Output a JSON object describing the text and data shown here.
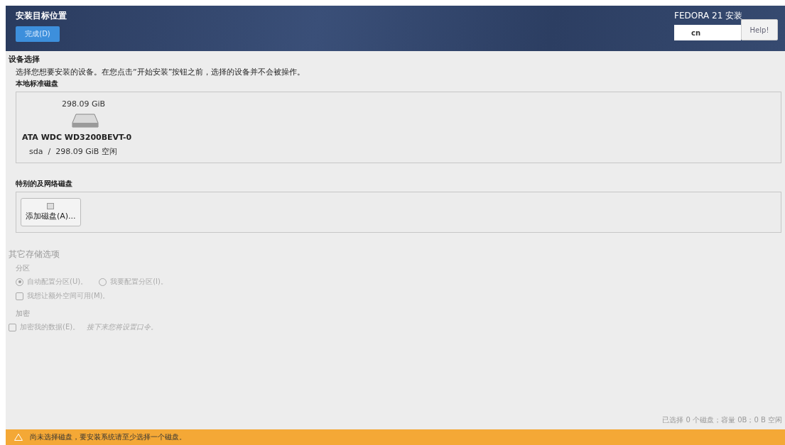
{
  "header": {
    "title": "安装目标位置",
    "done_button": "完成(D)",
    "product": "FEDORA 21 安装",
    "keyboard": "cn",
    "help_button": "Help!"
  },
  "device_selection": {
    "title": "设备选择",
    "description": "选择您想要安装的设备。在您点击“开始安装”按钮之前，选择的设备并不会被操作。",
    "local_disks": {
      "label": "本地标准磁盘",
      "disks": [
        {
          "size": "298.09 GiB",
          "name": "ATA WDC WD3200BEVT-0",
          "device": "sda",
          "separator": "/",
          "free": "298.09 GiB 空闲",
          "selected": false
        }
      ]
    },
    "special_disks": {
      "label": "特别的及网络磁盘",
      "add_button": "添加磁盘(A)..."
    }
  },
  "other_options": {
    "title": "其它存储选项",
    "disabled": true,
    "partitioning": {
      "label": "分区",
      "radios": [
        {
          "label": "自动配置分区(U)。",
          "selected": true
        },
        {
          "label": "我要配置分区(I)。",
          "selected": false
        }
      ],
      "extra_space": {
        "label": "我想让额外空间可用(M)。",
        "checked": false
      }
    },
    "encryption": {
      "label": "加密",
      "checkbox": {
        "label": "加密我的数据(E)。",
        "checked": false
      },
      "note": "接下来您将设置口令。"
    }
  },
  "summary": "已选择 0 个磁盘；容量 0B；0 B 空闲",
  "warning": "尚未选择磁盘，要安装系统请至少选择一个磁盘。"
}
